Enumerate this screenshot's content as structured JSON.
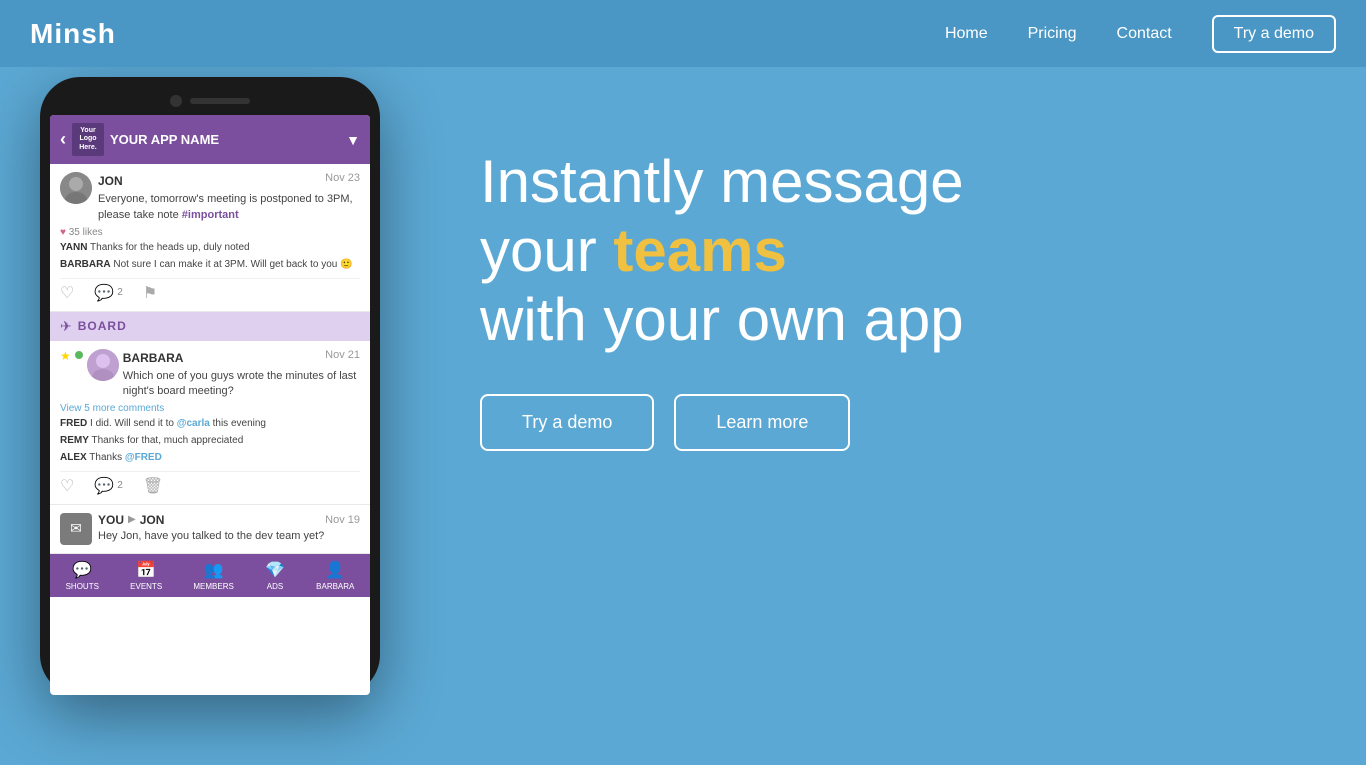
{
  "brand": "Minsh",
  "nav": {
    "home": "Home",
    "pricing": "Pricing",
    "contact": "Contact",
    "try_demo": "Try a demo"
  },
  "app": {
    "name": "YOUR APP NAME",
    "logo_text": "Your\nLogo\nHere.",
    "posts": [
      {
        "author": "JON",
        "date": "Nov 23",
        "text": "Everyone, tomorrow's meeting is postponed to 3PM, please take note",
        "tag": "#important",
        "likes": "35 likes",
        "comments": [
          {
            "author": "YANN",
            "text": "Thanks for the heads up, duly noted"
          },
          {
            "author": "BARBARA",
            "text": "Not sure I can make it at 3PM. Will get back to you 🙂"
          }
        ],
        "action_comments": "2"
      }
    ],
    "board_label": "BOARD",
    "board_posts": [
      {
        "author": "BARBARA",
        "date": "Nov 21",
        "text": "Which one of you guys wrote the minutes of last night's board meeting?",
        "view_more": "View 5 more comments",
        "comments": [
          {
            "author": "FRED",
            "text": "I did. Will send it to",
            "mention": "@carla",
            "suffix": " this evening"
          },
          {
            "author": "REMY",
            "text": "Thanks for that, much appreciated"
          },
          {
            "author": "ALEX",
            "text": "Thanks",
            "mention": "@FRED",
            "suffix": ""
          }
        ],
        "action_comments": "2"
      }
    ],
    "dm": {
      "from": "YOU",
      "to": "JON",
      "date": "Nov 19",
      "text": "Hey Jon, have you talked to the dev team yet?"
    },
    "bottom_nav": [
      {
        "label": "SHOUTS",
        "icon": "💬"
      },
      {
        "label": "EVENTS",
        "icon": "📅"
      },
      {
        "label": "MEMBERS",
        "icon": "👥"
      },
      {
        "label": "ADS",
        "icon": "💎"
      },
      {
        "label": "BARBARA",
        "icon": "👤"
      }
    ]
  },
  "hero": {
    "line1": "Instantly message",
    "line2_before": "your ",
    "line2_accent": "teams",
    "line3": "with your own app",
    "btn_demo": "Try a demo",
    "btn_learn": "Learn more"
  }
}
